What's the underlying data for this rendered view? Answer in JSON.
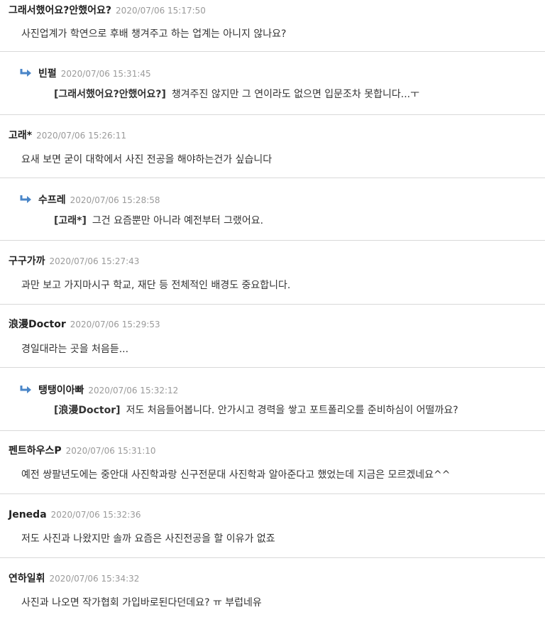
{
  "comments": [
    {
      "author": "그래서했어요?안했어요?",
      "date": "2020/07/06 15:17:50",
      "text": "사진업계가 학연으로 후배 챙겨주고 하는 업계는 아니지 않나요?",
      "reply": false
    },
    {
      "author": "빈펄",
      "date": "2020/07/06 15:31:45",
      "ref": "[그래서했어요?안했어요?]",
      "text": "챙겨주진 않지만 그 연이라도 없으면 입문조차 못합니다...ㅜ",
      "reply": true
    },
    {
      "author": "고래*",
      "date": "2020/07/06 15:26:11",
      "text": "요새 보면 굳이 대학에서 사진 전공을 해야하는건가 싶습니다",
      "reply": false
    },
    {
      "author": "수프레",
      "date": "2020/07/06 15:28:58",
      "ref": "[고래*]",
      "text": "그건 요즘뿐만 아니라 예전부터 그랬어요.",
      "reply": true
    },
    {
      "author": "구구가까",
      "date": "2020/07/06 15:27:43",
      "text": "과만 보고 가지마시구 학교, 재단 등 전체적인 배경도 중요합니다.",
      "reply": false
    },
    {
      "author": "浪漫Doctor",
      "date": "2020/07/06 15:29:53",
      "text": "경일대라는 곳을 처음듣...",
      "reply": false
    },
    {
      "author": "탱탱이아빠",
      "date": "2020/07/06 15:32:12",
      "ref": "[浪漫Doctor]",
      "text": "저도 처음들어봅니다. 안가시고 경력을 쌓고 포트폴리오를 준비하심이 어떨까요?",
      "reply": true
    },
    {
      "author": "펜트하우스P",
      "date": "2020/07/06 15:31:10",
      "text": "예전 쌍팔년도에는 중안대 사진학과랑 신구전문대 사진학과 알아준다고 했었는데 지금은 모르겠네요^^",
      "reply": false
    },
    {
      "author": "Jeneda",
      "date": "2020/07/06 15:32:36",
      "text": "저도 사진과 나왔지만 솔까 요즘은 사진전공을 할 이유가 없죠",
      "reply": false
    },
    {
      "author": "연하일휘",
      "date": "2020/07/06 15:34:32",
      "text": "사진과 나오면 작가협회 가입바로된다던데요? ㅠ 부럽네유",
      "reply": false
    }
  ],
  "colors": {
    "reply_arrow": "#4a86c8",
    "divider": "#d9d9d9",
    "date": "#9a9a9a"
  },
  "icons": {
    "reply": "reply-arrow-icon"
  }
}
